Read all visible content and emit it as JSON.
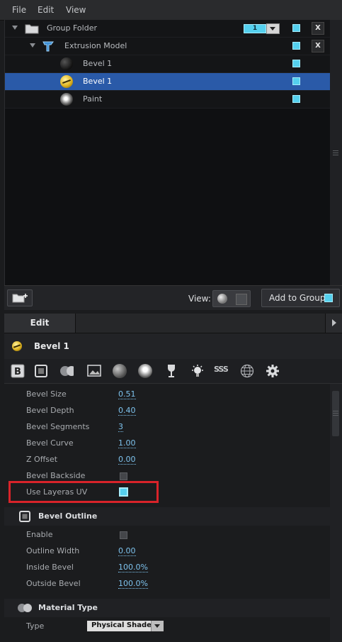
{
  "menu": {
    "file": "File",
    "edit": "Edit",
    "view": "View"
  },
  "tree": {
    "rows": [
      {
        "label": "Group Folder",
        "icon": "folder-icon",
        "layer_value": "1"
      },
      {
        "label": "Extrusion Model",
        "icon": "extrusion-model-icon"
      },
      {
        "label": "Bevel 1",
        "icon": "dark-sphere-material-icon"
      },
      {
        "label": "Bevel 1",
        "icon": "gold-material-icon",
        "selected": true
      },
      {
        "label": "Paint",
        "icon": "chrome-sphere-material-icon"
      }
    ],
    "close_label": "X"
  },
  "footer": {
    "view_label": "View:",
    "add_to_group": "Add to Group"
  },
  "edit_tab": "Edit",
  "object_name": "Bevel 1",
  "toolbar_icons": [
    "bevel-b-icon",
    "bevel-outline-icon",
    "material-type-icon",
    "image-icon",
    "sphere-icon",
    "face-sphere-icon",
    "glass-icon",
    "light-bulb-icon",
    "sss-icon",
    "wireframe-sphere-icon",
    "gear-icon"
  ],
  "sss_text": "SSS",
  "bevel_props": [
    {
      "label": "Bevel Size",
      "value": "0.51"
    },
    {
      "label": "Bevel Depth",
      "value": "0.40"
    },
    {
      "label": "Bevel Segments",
      "value": "3"
    },
    {
      "label": "Bevel Curve",
      "value": "1.00"
    },
    {
      "label": "Z Offset",
      "value": "0.00"
    },
    {
      "label": "Bevel Backside",
      "checked": false
    },
    {
      "label": "Use Layeras UV",
      "checked": true
    }
  ],
  "outline_section": {
    "title": "Bevel Outline",
    "props": [
      {
        "label": "Enable",
        "checked": false
      },
      {
        "label": "Outline Width",
        "value": "0.00"
      },
      {
        "label": "Inside Bevel",
        "value": "100.0%"
      },
      {
        "label": "Outside Bevel",
        "value": "100.0%"
      }
    ]
  },
  "material_section": {
    "title": "Material Type",
    "type_label": "Type",
    "type_value": "Physical Shader"
  },
  "colors": {
    "accent": "#55d0ee",
    "selection": "#2a5aa8",
    "highlight": "#d8232a",
    "link": "#7ec3ee"
  }
}
